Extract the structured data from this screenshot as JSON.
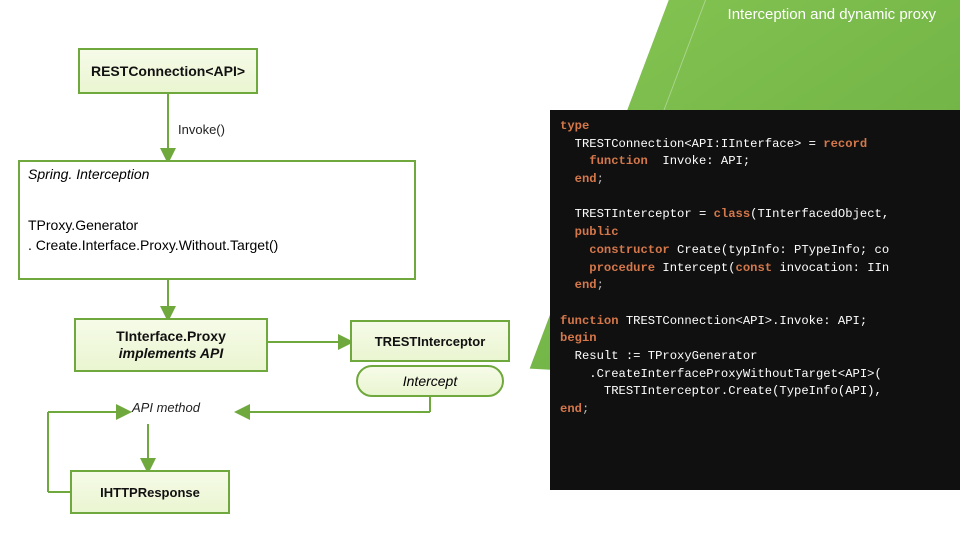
{
  "title": "Interception and dynamic proxy",
  "nodes": {
    "rest_conn": "RESTConnection<API>",
    "invoke_label": "Invoke()",
    "spring_title": "Spring. Interception",
    "spring_body1": "TProxy.Generator",
    "spring_body2": ". Create.Interface.Proxy.Without.Target()",
    "iface_proxy_l1": "TInterface.Proxy",
    "iface_proxy_l2": "implements API",
    "api_method": "API method",
    "ihttp": "IHTTPResponse",
    "trest_interceptor": "TRESTInterceptor",
    "intercept": "Intercept"
  },
  "code": {
    "l1a": "type",
    "l1b": "",
    "l2a": "  TRESTConnection<API:IInterface> = ",
    "l2b": "record",
    "l3a": "    ",
    "l3b": "function",
    "l3c": "  Invoke: API;",
    "l4a": "  ",
    "l4b": "end",
    "l4c": ";",
    "blank1": "",
    "l5a": "  TRESTInterceptor = ",
    "l5b": "class",
    "l5c": "(TInterfacedObject,",
    "l6a": "  ",
    "l6b": "public",
    "l7a": "    ",
    "l7b": "constructor",
    "l7c": " Create(typInfo: PTypeInfo; co",
    "l8a": "    ",
    "l8b": "procedure",
    "l8c": " Intercept(",
    "l8d": "const",
    "l8e": " invocation: IIn",
    "l9a": "  ",
    "l9b": "end",
    "l9c": ";",
    "blank2": "",
    "l10a": "function",
    "l10b": " TRESTConnection<API>.Invoke: API;",
    "l11a": "begin",
    "l12": "  Result := TProxyGenerator",
    "l13": "    .CreateInterfaceProxyWithoutTarget<API>(",
    "l14": "      TRESTInterceptor.Create(TypeInfo(API),",
    "l15a": "end",
    "l15b": ";"
  }
}
